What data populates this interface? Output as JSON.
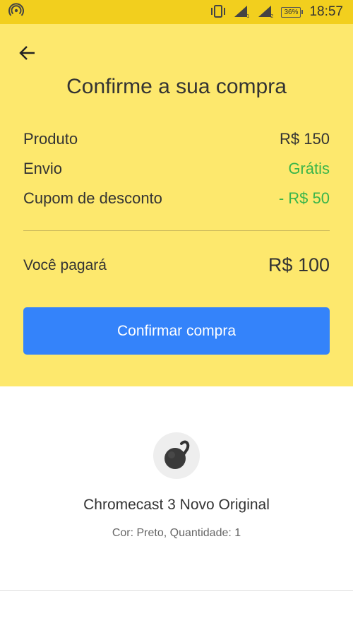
{
  "status_bar": {
    "time": "18:57",
    "battery": "36%"
  },
  "header": {
    "title": "Confirme a sua compra",
    "rows": [
      {
        "label": "Produto",
        "value": "R$ 150"
      },
      {
        "label": "Envio",
        "value": "Grátis"
      },
      {
        "label": "Cupom de desconto",
        "value": "- R$ 50"
      }
    ],
    "total_label": "Você pagará",
    "total_value": "R$ 100",
    "confirm_label": "Confirmar compra"
  },
  "product": {
    "name": "Chromecast 3 Novo Original",
    "details": "Cor: Preto, Quantidade: 1"
  },
  "colors": {
    "status_bar": "#f2cf1e",
    "header_bg": "#fde86d",
    "primary": "#3483fa",
    "free_green": "#39b54a"
  },
  "icons": [
    "hotspot-icon",
    "vibrate-icon",
    "signal-icon",
    "battery-icon",
    "back-arrow-icon"
  ]
}
